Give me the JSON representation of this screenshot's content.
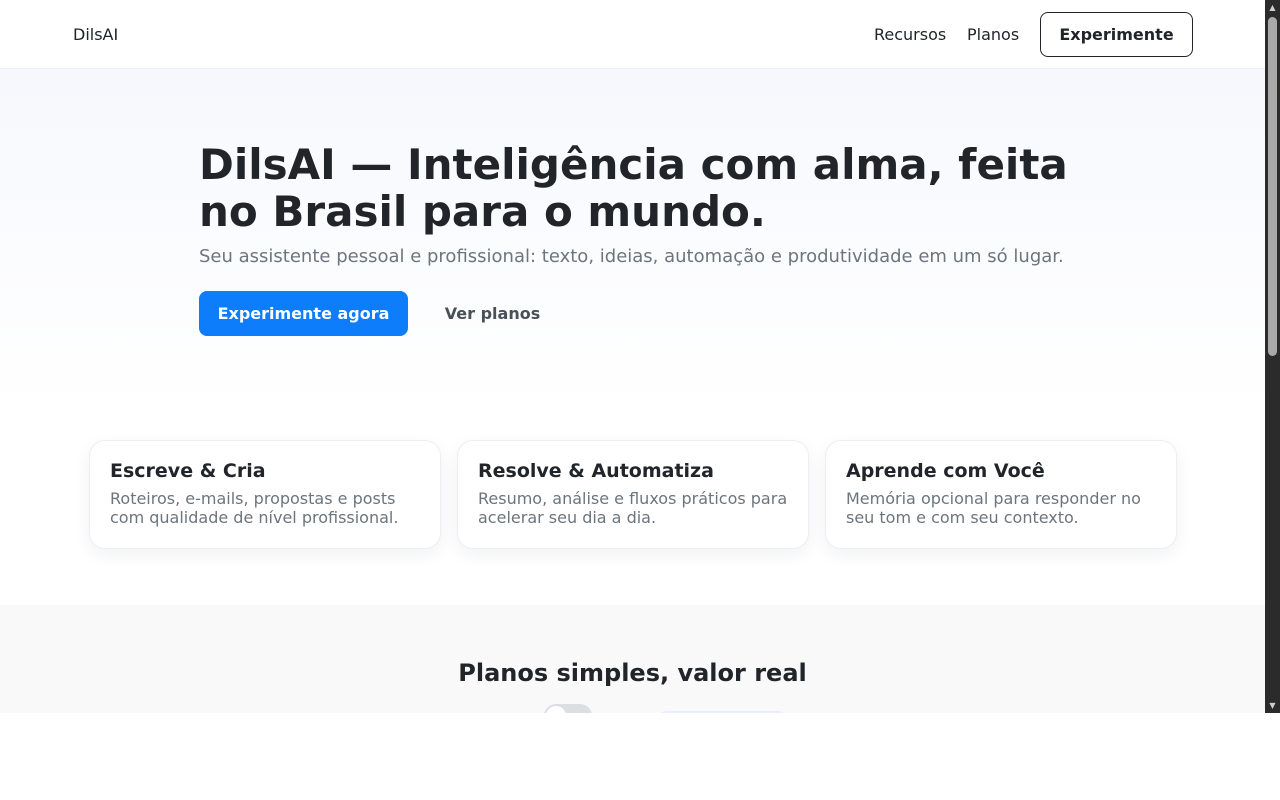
{
  "navbar": {
    "brand": "DilsAI",
    "links": [
      {
        "label": "Recursos"
      },
      {
        "label": "Planos"
      }
    ],
    "cta_label": "Experimente"
  },
  "hero": {
    "title": "DilsAI — Inteligência com alma, feita no Brasil para o mundo.",
    "subtitle": "Seu assistente pessoal e profissional: texto, ideias, automação e produtividade em um só lugar.",
    "primary_label": "Experimente agora",
    "secondary_label": "Ver planos"
  },
  "features": [
    {
      "title": "Escreve & Cria",
      "description": "Roteiros, e-mails, propostas e posts com qualidade de nível profissional."
    },
    {
      "title": "Resolve & Automatiza",
      "description": "Resumo, análise e fluxos práticos para acelerar seu dia a dia."
    },
    {
      "title": "Aprende com Você",
      "description": "Memória opcional para responder no seu tom e com seu contexto."
    }
  ],
  "plans": {
    "title": "Planos simples, valor real",
    "toggle_on": false
  },
  "colors": {
    "primary": "#0d7dfc",
    "text": "#212529",
    "muted": "#6c757d"
  },
  "icons": {
    "scroll_up": "triangle-up-icon",
    "scroll_down": "triangle-down-icon"
  }
}
